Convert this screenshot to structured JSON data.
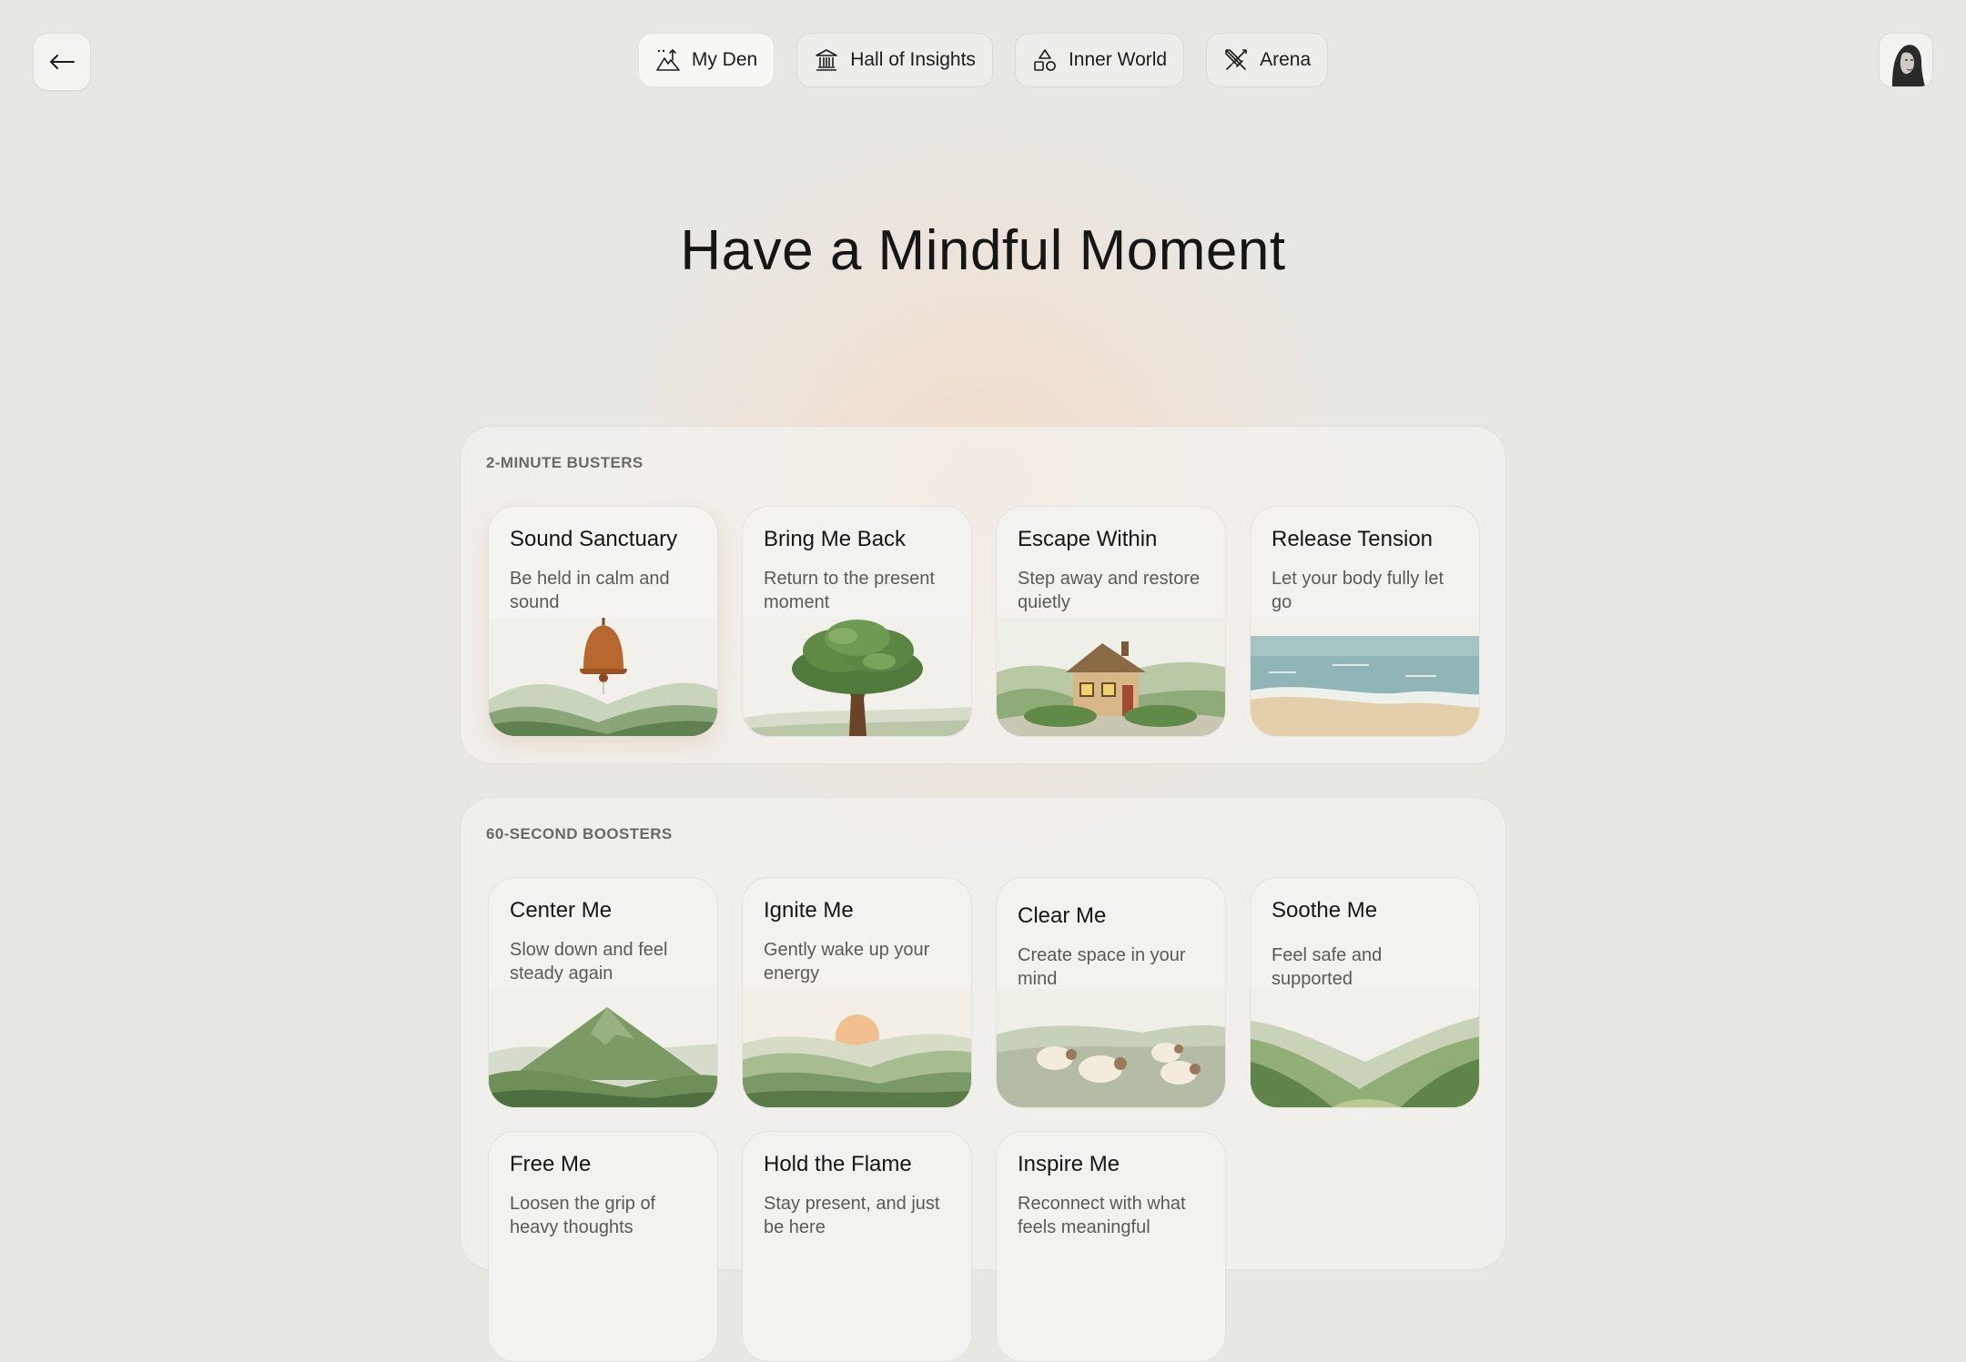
{
  "nav": {
    "items": [
      {
        "label": "My Den",
        "icon": "mountain-flag-icon"
      },
      {
        "label": "Hall of Insights",
        "icon": "museum-icon"
      },
      {
        "label": "Inner World",
        "icon": "shapes-icon"
      },
      {
        "label": "Arena",
        "icon": "crossed-swords-icon"
      }
    ],
    "active": "My Den"
  },
  "page": {
    "title": "Have a Mindful Moment"
  },
  "sections": [
    {
      "label": "2-MINUTE BUSTERS",
      "cards": [
        {
          "title": "Sound Sanctuary",
          "desc": "Be held in calm and sound",
          "art": "bell-illustration"
        },
        {
          "title": "Bring Me Back",
          "desc": "Return to the present moment",
          "art": "tree-illustration"
        },
        {
          "title": "Escape Within",
          "desc": "Step away and restore quietly",
          "art": "cottage-illustration"
        },
        {
          "title": "Release Tension",
          "desc": "Let your body fully let go",
          "art": "ocean-illustration"
        }
      ]
    },
    {
      "label": "60-SECOND BOOSTERS",
      "cards": [
        {
          "title": "Center Me",
          "desc": "Slow down and feel steady again",
          "art": "mountain-illustration"
        },
        {
          "title": "Ignite Me",
          "desc": "Gently wake up your energy",
          "art": "sunrise-illustration"
        },
        {
          "title": "Clear Me",
          "desc": "Create space in your mind",
          "art": "sheep-illustration"
        },
        {
          "title": "Soothe Me",
          "desc": "Feel safe and supported",
          "art": "valley-illustration"
        },
        {
          "title": "Free Me",
          "desc": "Loosen the grip of heavy thoughts",
          "art": ""
        },
        {
          "title": "Hold the Flame",
          "desc": "Stay present, and just be here",
          "art": ""
        },
        {
          "title": "Inspire Me",
          "desc": "Reconnect with what feels meaningful",
          "art": ""
        }
      ]
    }
  ],
  "colors": {
    "background": "#e9e7e2",
    "card": "#f4f2ee",
    "accent_glow": "#f4d6be",
    "hill_green": "#6e9a5e"
  }
}
